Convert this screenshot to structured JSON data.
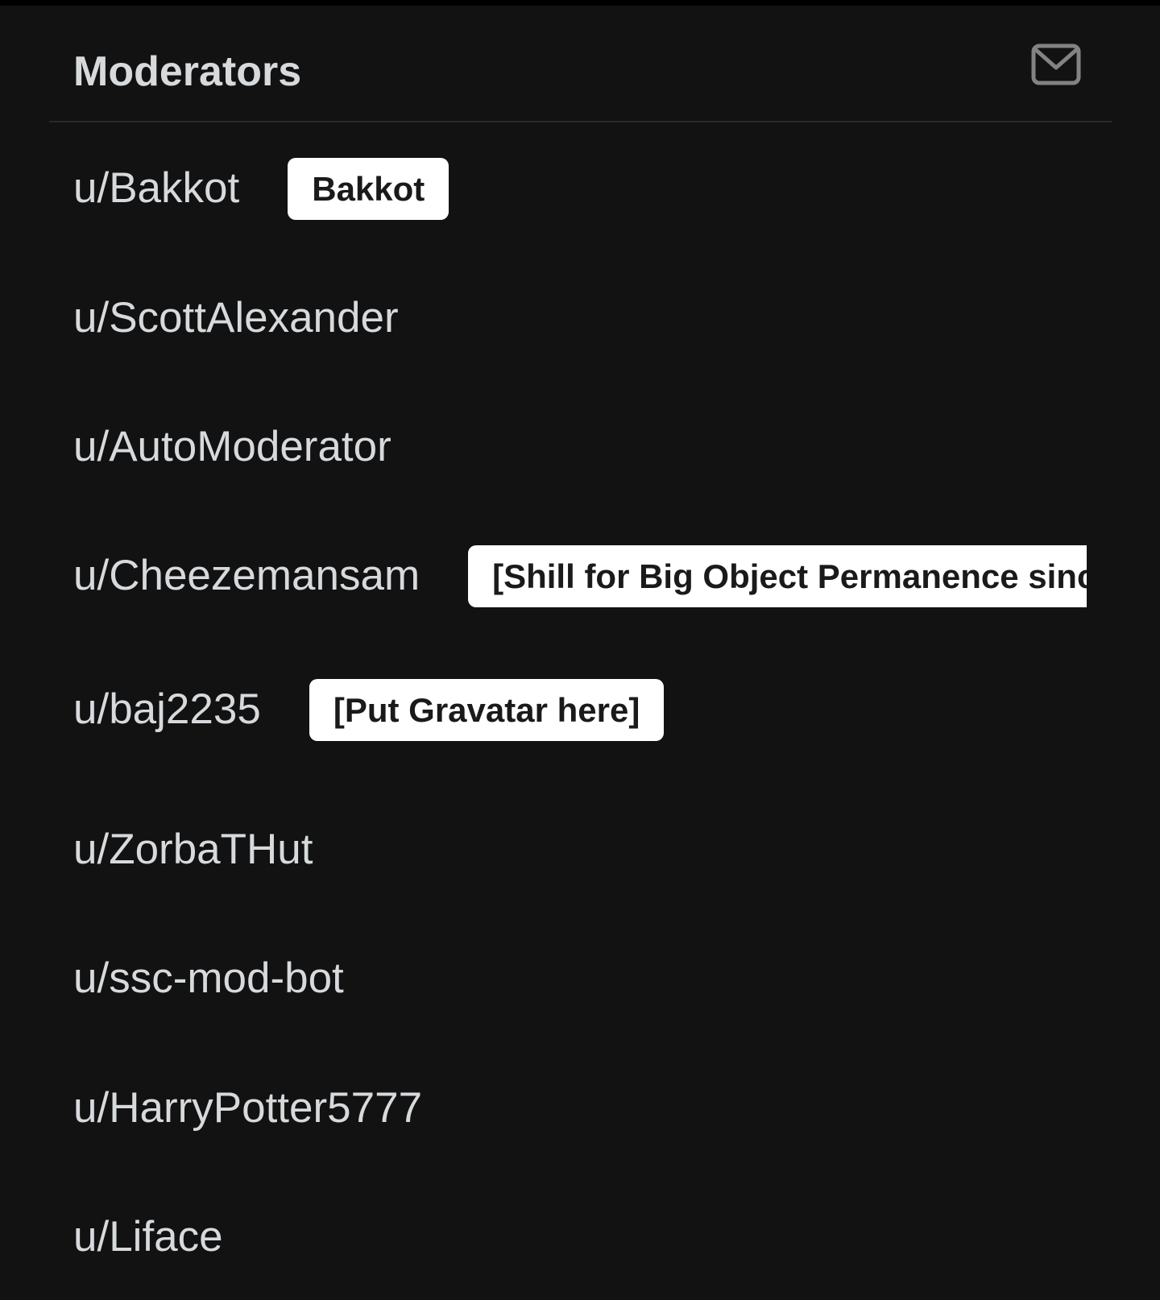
{
  "header": {
    "title": "Moderators",
    "message_icon": "mail-icon"
  },
  "moderators": [
    {
      "username": "u/Bakkot",
      "flair": "Bakkot"
    },
    {
      "username": "u/ScottAlexander",
      "flair": ""
    },
    {
      "username": "u/AutoModerator",
      "flair": ""
    },
    {
      "username": "u/Cheezemansam",
      "flair": "[Shill for Big Object Permanence since"
    },
    {
      "username": "u/baj2235",
      "flair": "[Put Gravatar here]"
    },
    {
      "username": "u/ZorbaTHut",
      "flair": ""
    },
    {
      "username": "u/ssc-mod-bot",
      "flair": ""
    },
    {
      "username": "u/HarryPotter5777",
      "flair": ""
    },
    {
      "username": "u/Liface",
      "flair": ""
    }
  ],
  "colors": {
    "background": "#121213",
    "text": "#d7dadc",
    "flair_background": "#ffffff",
    "flair_text": "#1a1a1b"
  }
}
